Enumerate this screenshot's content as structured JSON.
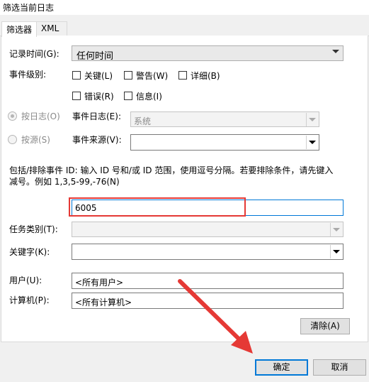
{
  "window": {
    "title": "筛选当前日志"
  },
  "tabs": [
    {
      "label": "筛选器",
      "active": true
    },
    {
      "label": "XML",
      "active": false
    }
  ],
  "logged": {
    "label": "记录时间(G):",
    "value": "任何时间"
  },
  "event_level": {
    "label": "事件级别:",
    "options": [
      {
        "label": "关键(L)",
        "checked": false
      },
      {
        "label": "警告(W)",
        "checked": false
      },
      {
        "label": "详细(B)",
        "checked": false
      },
      {
        "label": "错误(R)",
        "checked": false
      },
      {
        "label": "信息(I)",
        "checked": false
      }
    ]
  },
  "by_log": {
    "label": "按日志(O)",
    "selected": true,
    "field_label": "事件日志(E):",
    "value": "系统"
  },
  "by_source": {
    "label": "按源(S)",
    "selected": false,
    "field_label": "事件来源(V):",
    "value": ""
  },
  "event_ids": {
    "description_line1": "包括/排除事件 ID: 输入 ID 号和/或 ID 范围，使用逗号分隔。若要排除条件，请先键入",
    "description_line2": "减号。例如 1,3,5-99,-76(N)",
    "value": "6005"
  },
  "task_category": {
    "label": "任务类别(T):",
    "value": ""
  },
  "keywords": {
    "label": "关键字(K):",
    "value": ""
  },
  "user": {
    "label": "用户(U):",
    "value": "<所有用户>"
  },
  "computer": {
    "label": "计算机(P):",
    "value": "<所有计算机>"
  },
  "buttons": {
    "clear": "清除(A)",
    "ok": "确定",
    "cancel": "取消"
  },
  "colors": {
    "highlight_box": "#e53935",
    "annotation_arrow": "#e53935",
    "default_button_border": "#0078d7"
  }
}
